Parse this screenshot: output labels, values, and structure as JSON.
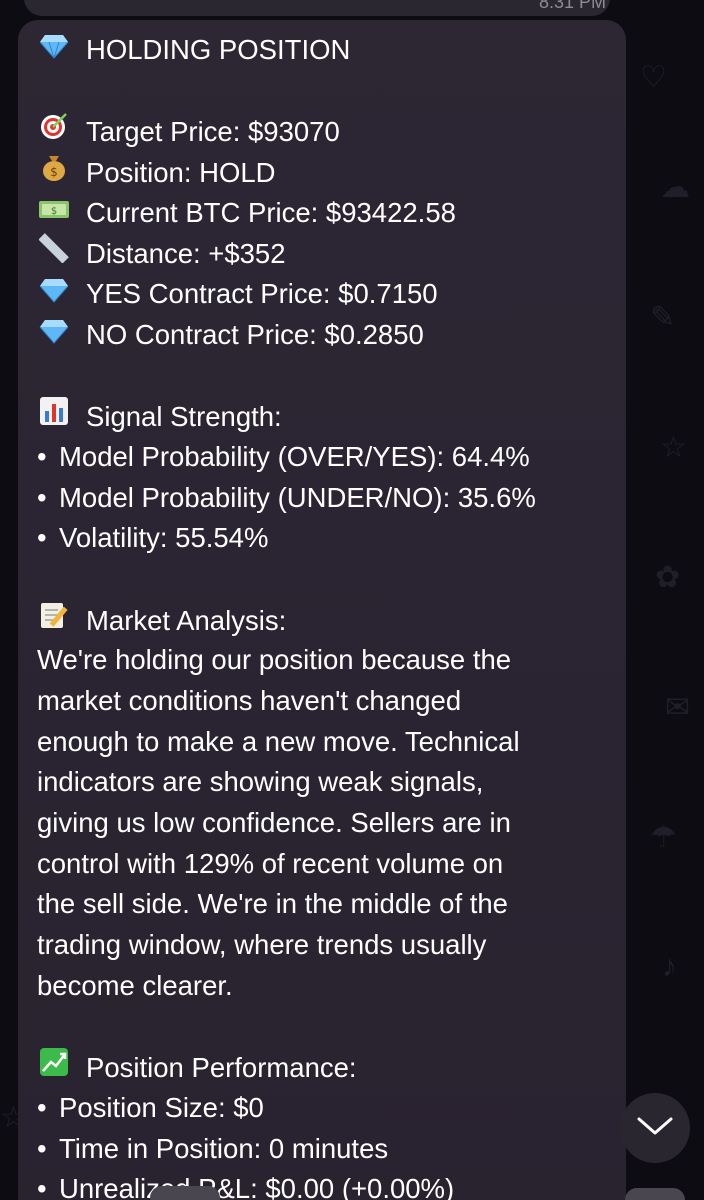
{
  "previous_message": {
    "time": "8:31 PM"
  },
  "message": {
    "header": {
      "icon": "gem-icon",
      "text": "HOLDING POSITION"
    },
    "details": [
      {
        "icon": "target-icon",
        "label": "Target Price: $93070"
      },
      {
        "icon": "money-bag-icon",
        "label": "Position: HOLD"
      },
      {
        "icon": "dollar-bills-icon",
        "label": "Current BTC Price: $93422.58"
      },
      {
        "icon": "ruler-icon",
        "label": "Distance: +$352"
      },
      {
        "icon": "gem-icon",
        "label": "YES Contract Price: $0.7150"
      },
      {
        "icon": "gem-icon",
        "label": "NO Contract Price: $0.2850"
      }
    ],
    "signal": {
      "icon": "bar-chart-icon",
      "title": "Signal Strength:",
      "items": [
        "Model Probability (OVER/YES): 64.4%",
        "Model Probability (UNDER/NO): 35.6%",
        "Volatility: 55.54%"
      ]
    },
    "analysis": {
      "icon": "memo-icon",
      "title": "Market Analysis:",
      "lines": [
        "We're holding our position because the",
        "market conditions haven't changed",
        "enough to make a new move. Technical",
        "indicators are showing weak signals,",
        "giving us low confidence. Sellers are in",
        "control with 129% of recent volume on",
        "the sell side. We're in the middle of the",
        "trading window, where trends usually",
        "become clearer."
      ]
    },
    "performance": {
      "icon": "chart-increasing-yen-icon",
      "title": "Position Performance:",
      "items": [
        "Position Size: $0",
        "Time in Position: 0 minutes",
        "Unrealized P&L: $0.00 (+0.00%)"
      ]
    }
  },
  "bullet": "•",
  "colors": {
    "bubble": "#2c2633",
    "text": "#ffffff",
    "gem": "#5fb7f5",
    "chart_green": "#3dbb4a"
  }
}
